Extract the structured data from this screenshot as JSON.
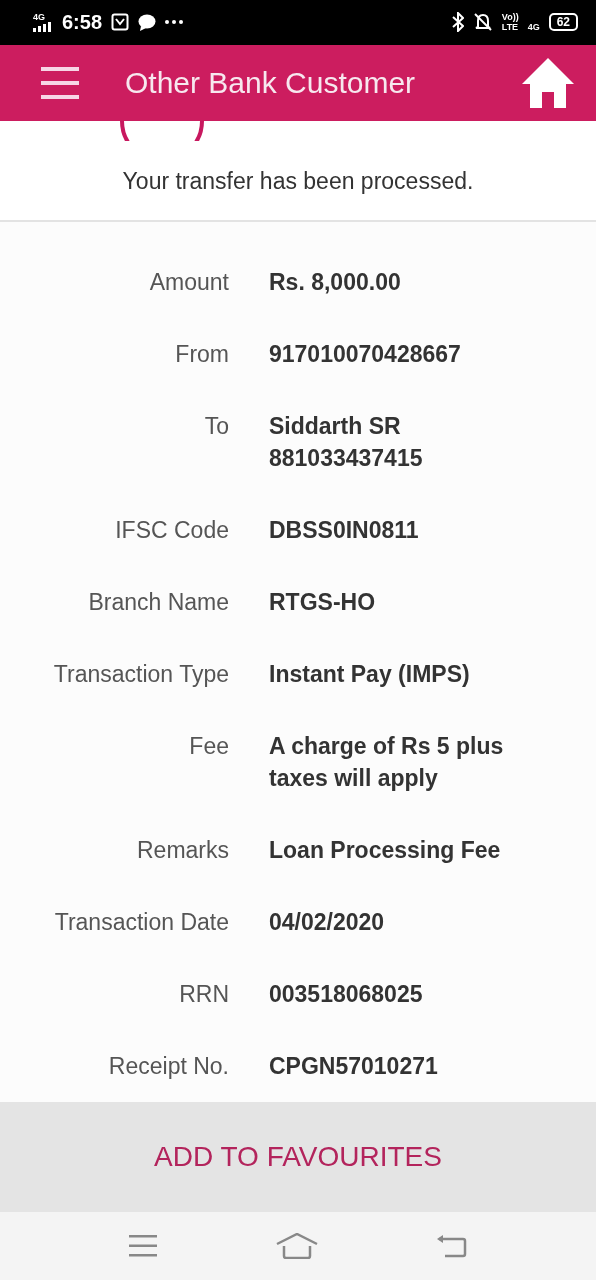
{
  "status_bar": {
    "network_left": "4G",
    "time": "6:58",
    "volte_top": "Vo))",
    "volte_bottom": "LTE",
    "network_right": "4G",
    "battery": "62"
  },
  "header": {
    "title": "Other Bank Customer"
  },
  "message": "Your transfer has been processed.",
  "details": [
    {
      "label": "Amount",
      "lines": [
        "Rs. 8,000.00"
      ]
    },
    {
      "label": "From",
      "lines": [
        "917010070428667"
      ]
    },
    {
      "label": "To",
      "lines": [
        "Siddarth SR",
        "881033437415"
      ]
    },
    {
      "label": "IFSC Code",
      "lines": [
        "DBSS0IN0811"
      ]
    },
    {
      "label": "Branch Name",
      "lines": [
        "RTGS-HO"
      ]
    },
    {
      "label": "Transaction Type",
      "lines": [
        "Instant Pay (IMPS)"
      ]
    },
    {
      "label": "Fee",
      "lines": [
        "A charge of Rs 5 plus taxes will apply"
      ]
    },
    {
      "label": "Remarks",
      "lines": [
        "Loan Processing Fee"
      ]
    },
    {
      "label": "Transaction Date",
      "lines": [
        "04/02/2020"
      ]
    },
    {
      "label": "RRN",
      "lines": [
        "003518068025"
      ]
    },
    {
      "label": "Receipt No.",
      "lines": [
        "CPGN57010271"
      ]
    }
  ],
  "action_button": "ADD TO FAVOURITES"
}
